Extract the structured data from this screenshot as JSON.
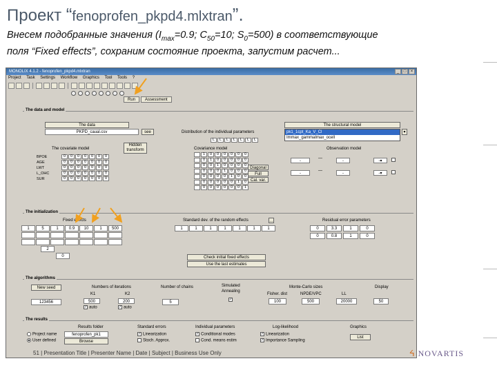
{
  "slide": {
    "title_prefix": "Проект ",
    "title_open_quote": "“",
    "title_project": "fenoprofen_pkpd4.mlxtran",
    "title_close": "”.",
    "subtitle_line1_a": "Внесем подобранные значения (I",
    "sub_max": "max",
    "subtitle_line1_b": "=0.9; C",
    "sub_50": "50",
    "subtitle_line1_c": "=10; S",
    "sub_0": "0",
    "subtitle_line1_d": "=500) в соответствующие",
    "subtitle_line2": "поля “Fixed effects”, сохраним состояние проекта, запустим расчет...",
    "footer": "51 | Presentation Title | Presenter Name | Date | Subject | Business Use Only",
    "logo": "NOVARTIS"
  },
  "window": {
    "title": "MONOLIX 4.1.2 - fenoprofen_pkpd4.mlxtran",
    "menu": [
      "Project",
      "Task",
      "Settings",
      "Workflow",
      "Graphics",
      "Tool",
      "Tools",
      "?"
    ],
    "run_label": "Run",
    "assessment_label": "Assessment"
  },
  "data_model": {
    "header": "The data and model",
    "data_label": "The data",
    "data_file": "PKPD_caual.csv",
    "see_label": "see",
    "distribution_label": "Distribution of the individual parameters",
    "structural_label": "The structural model",
    "structural_items": [
      "pk1_1cpt_Ka_V_Cl",
      "Immax_gammaImax_ocell"
    ],
    "covariate_label": "The covariate model",
    "hide_label": "Hidden",
    "transform_label": "transform",
    "covariance_label": "Covariance model",
    "observation_label": "Observation model",
    "cov_rows": [
      "BPOE",
      "AGE",
      "LWT",
      "L_OHC",
      "SUR"
    ],
    "diagonal_label": "Diagonal",
    "full_label": "Full",
    "calvar_label": "Cal. var."
  },
  "init": {
    "header": "The initialization",
    "fixed_label": "Fixed effects",
    "stddev_label": "Standard dev. of the random effects",
    "residual_label": "Residual error parameters",
    "fixed_values": [
      "1",
      "5",
      "1",
      "0.9",
      "10",
      "1",
      "500"
    ],
    "stddev_values": [
      "1",
      "1",
      "1",
      "1",
      "1",
      "1",
      "1"
    ],
    "residual_row1": [
      "0",
      "3.3",
      "1",
      "0"
    ],
    "residual_row2": [
      "0",
      "0.8",
      "1",
      "0"
    ],
    "extra_value_1": "2",
    "extra_value_2": "0",
    "check_label": "Check initial fixed effects",
    "use_last_label": "Use the last estimates"
  },
  "algo": {
    "header": "The algorithms",
    "new_seed_label": "New seed",
    "seed_value": "123456",
    "iterations_label": "Numbers of iterations",
    "k1_label": "K1",
    "k2_label": "K2",
    "k1_value": "500",
    "k2_value": "200",
    "auto_label": "auto",
    "chains_label": "Number of chains",
    "chains_value": "5",
    "simulated_label": "Simulated",
    "annealing_label": "Annealing",
    "mc_label": "Monte-Carlo sizes",
    "fisher_label": "Fisher. dist",
    "npdepc_label": "NPDE/VPC",
    "ll_label": "LL",
    "fisher_value": "100",
    "npde_value": "500",
    "ll_value": "20000",
    "display_label": "Display",
    "display_value": "50"
  },
  "results": {
    "header": "The results",
    "folder_label": "Results folder",
    "project_name_label": "Project name",
    "user_defined_label": "User defined",
    "folder_value": "fenoprofen_pk1",
    "browse_label": "Browse",
    "std_errors_label": "Standard errors",
    "linearization_label": "Linearization",
    "stoch_label": "Stoch. Approx.",
    "indiv_label": "Individual parameters",
    "cond_modes_label": "Conditional modes",
    "cond_means_label": "Cond. means estim",
    "loglik_label": "Log-likelihood",
    "ll_lin_label": "Linearization",
    "importance_label": "Importance Sampling",
    "graphics_label": "Graphics",
    "list_label": "List"
  }
}
